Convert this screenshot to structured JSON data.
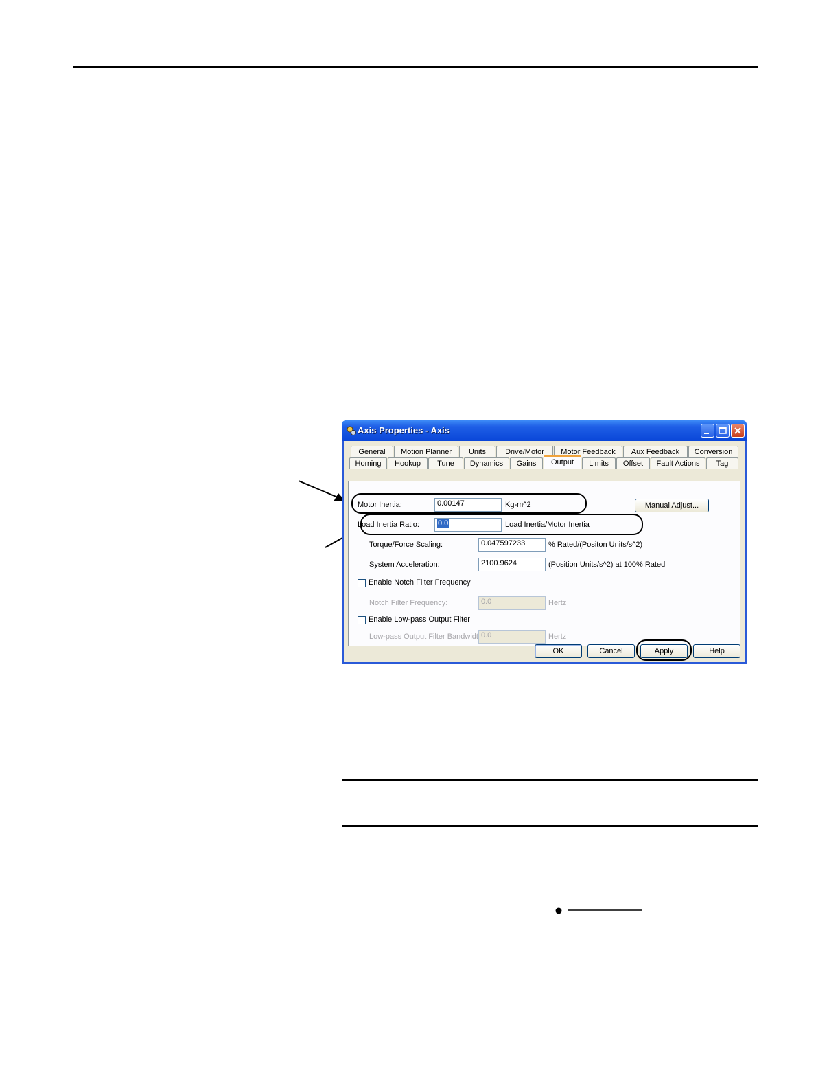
{
  "dialog": {
    "title": "Axis Properties - Axis",
    "tabs_row1": [
      "General",
      "Motion Planner",
      "Units",
      "Drive/Motor",
      "Motor Feedback",
      "Aux Feedback",
      "Conversion"
    ],
    "tabs_row2": [
      "Homing",
      "Hookup",
      "Tune",
      "Dynamics",
      "Gains",
      "Output",
      "Limits",
      "Offset",
      "Fault Actions",
      "Tag"
    ],
    "active_tab": "Output",
    "motor_inertia": {
      "label": "Motor Inertia:",
      "value": "0.00147",
      "unit": "Kg-m^2"
    },
    "manual_adjust_label": "Manual Adjust...",
    "load_inertia_ratio": {
      "label": "Load Inertia Ratio:",
      "value": "0.0",
      "unit": "Load Inertia/Motor Inertia"
    },
    "torque_scaling": {
      "label": "Torque/Force Scaling:",
      "value": "0.047597233",
      "unit": "% Rated/(Positon Units/s^2)"
    },
    "system_acceleration": {
      "label": "System Acceleration:",
      "value": "2100.9624",
      "unit": "(Position Units/s^2) at 100% Rated"
    },
    "notch_filter": {
      "checkbox_label": "Enable Notch Filter Frequency",
      "checked": false,
      "label": "Notch Filter Frequency:",
      "value": "0.0",
      "unit": "Hertz"
    },
    "lowpass_filter": {
      "checkbox_label": "Enable Low-pass Output Filter",
      "checked": false,
      "label": "Low-pass Output Filter Bandwidth:",
      "value": "0.0",
      "unit": "Hertz"
    },
    "buttons": {
      "ok": "OK",
      "cancel": "Cancel",
      "apply": "Apply",
      "help": "Help"
    }
  },
  "colors": {
    "titlebar": "#0a46d8",
    "dialog_face": "#ece9d8",
    "selection": "#316ac5",
    "link": "#1a3fd1"
  }
}
